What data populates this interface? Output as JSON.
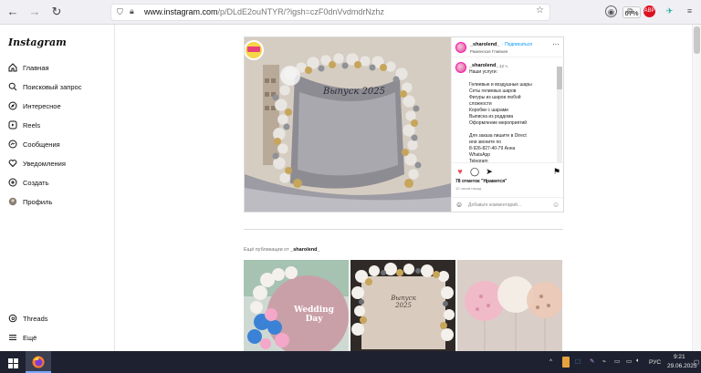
{
  "browser": {
    "url_host": "www.instagram.com",
    "url_path": "/p/DLdE2ouNTYR/?igsh=czF0dnVvdmdrNzhz",
    "zoom": "67%"
  },
  "sidebar": {
    "logo": "Instagram",
    "items": [
      {
        "label": "Главная",
        "icon": "home-icon"
      },
      {
        "label": "Поисковый запрос",
        "icon": "search-icon"
      },
      {
        "label": "Интересное",
        "icon": "explore-icon"
      },
      {
        "label": "Reels",
        "icon": "reels-icon"
      },
      {
        "label": "Сообщения",
        "icon": "messages-icon"
      },
      {
        "label": "Уведомления",
        "icon": "heart-icon"
      },
      {
        "label": "Создать",
        "icon": "create-icon"
      },
      {
        "label": "Профиль",
        "icon": "profile-icon"
      }
    ],
    "bottom_items": [
      {
        "label": "Threads",
        "icon": "threads-icon"
      },
      {
        "label": "Ещё",
        "icon": "menu-icon"
      }
    ]
  },
  "post": {
    "image_text": "Выпуск 2025",
    "author": "_sharolend_",
    "follow_label": "Подписаться",
    "location": "Раменское Главная",
    "caption_author": "_sharolend_",
    "caption_time": "12 ч.",
    "caption_lines": [
      "Наши услуги:",
      "",
      "Гелиевые и воздушные шары",
      "Сеты гелиевых шаров",
      "Фигуры из шаров любой",
      "сложности",
      "Коробки с шарами",
      "Выписка из роддома",
      "Оформление мероприятий",
      "",
      "Для заказа пишите в Direct",
      "или звоните по",
      "8-926-827-40-79 Анна",
      "WhatsApp",
      "Telegram"
    ],
    "likes": "78 отметок \"Нравится\"",
    "time_ago": "12 часов назад",
    "comment_placeholder": "Добавьте комментарий..."
  },
  "more_posts": {
    "prefix": "Ещё публикации от",
    "author": "_sharolend_",
    "thumbs": [
      {
        "text_line1": "Wedding",
        "text_line2": "Day"
      },
      {
        "text_line1": "Выпуск",
        "text_line2": "2025"
      },
      {
        "text_line1": "",
        "text_line2": ""
      }
    ]
  },
  "taskbar": {
    "lang": "РУС",
    "time": "9:21",
    "date": "29.06.2025"
  }
}
